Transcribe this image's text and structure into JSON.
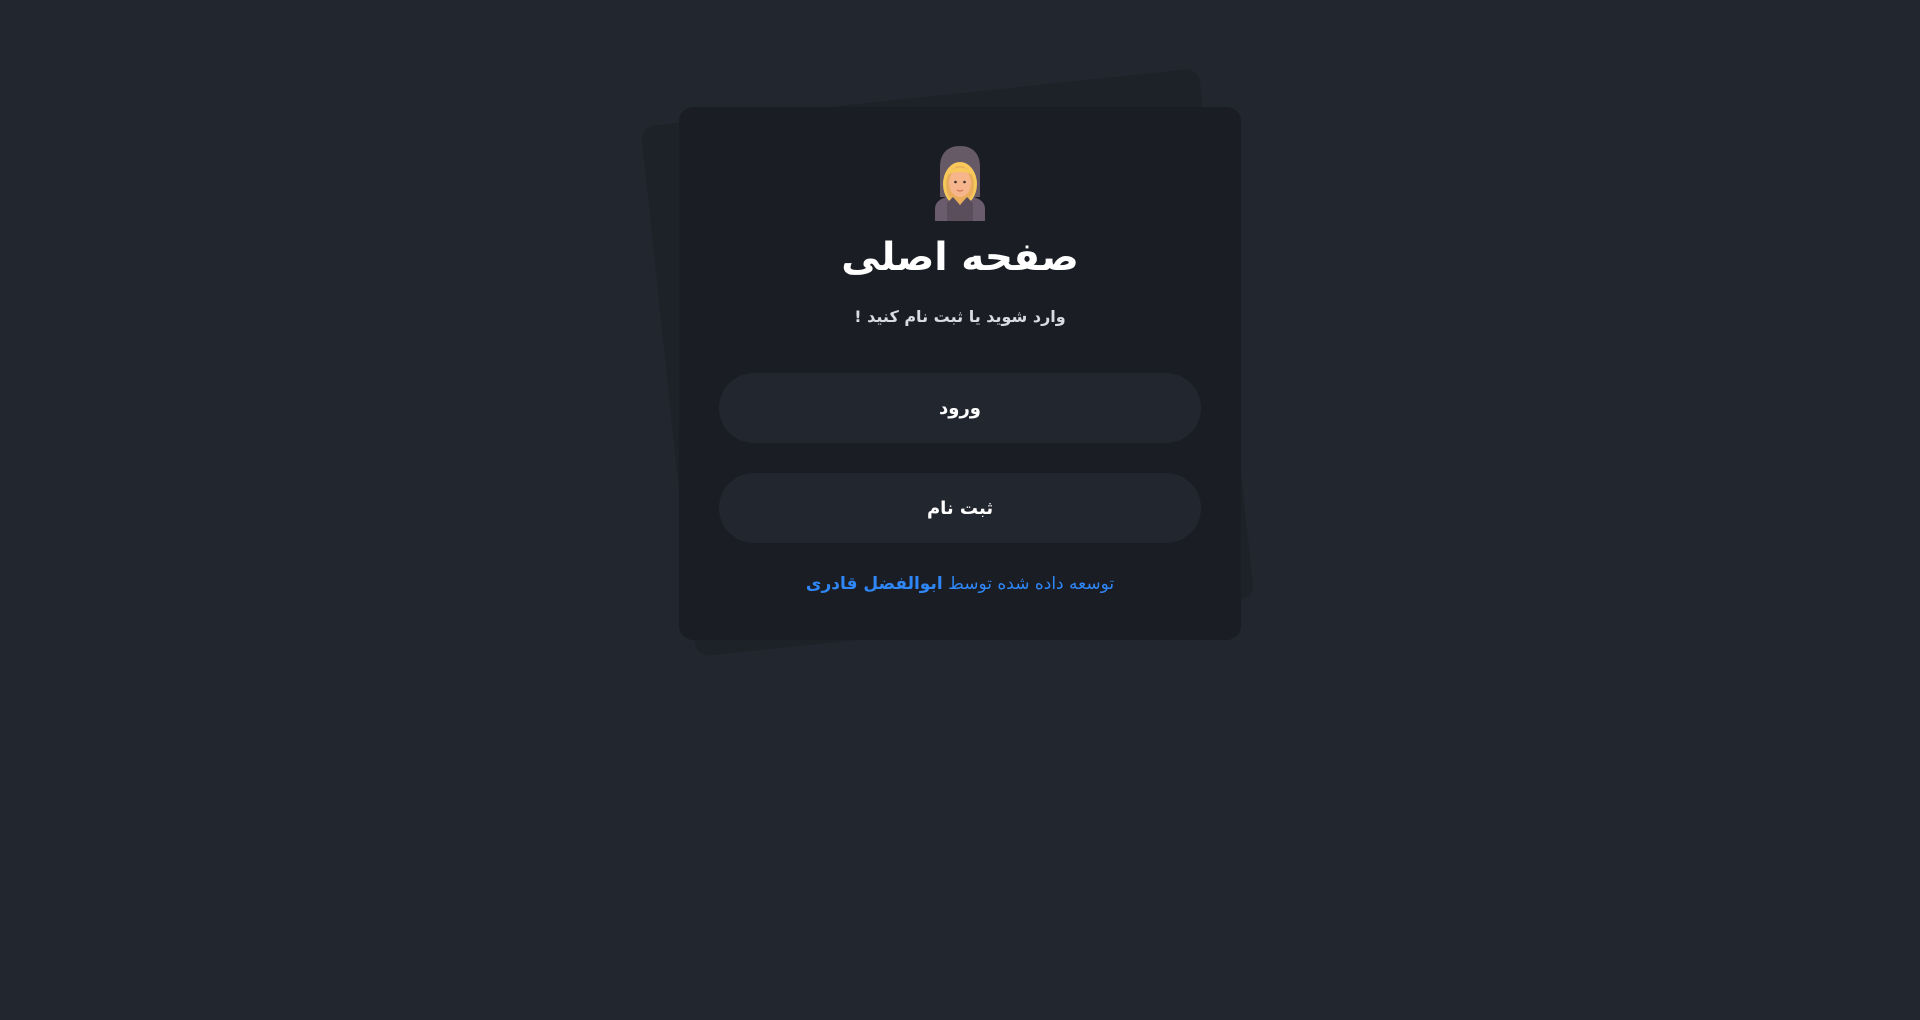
{
  "colors": {
    "background": "#22272f",
    "card": "#1a1d24",
    "button": "#22262e",
    "link": "#2f86f6"
  },
  "card": {
    "avatar_icon": "user-avatar-icon",
    "title": "صفحه اصلی",
    "subtitle": "وارد شوید یا ثبت نام کنید !",
    "login_label": "ورود",
    "signup_label": "ثبت نام",
    "footer_text": "توسعه داده شده توسط",
    "author_name": "ابوالفضل قادری"
  }
}
